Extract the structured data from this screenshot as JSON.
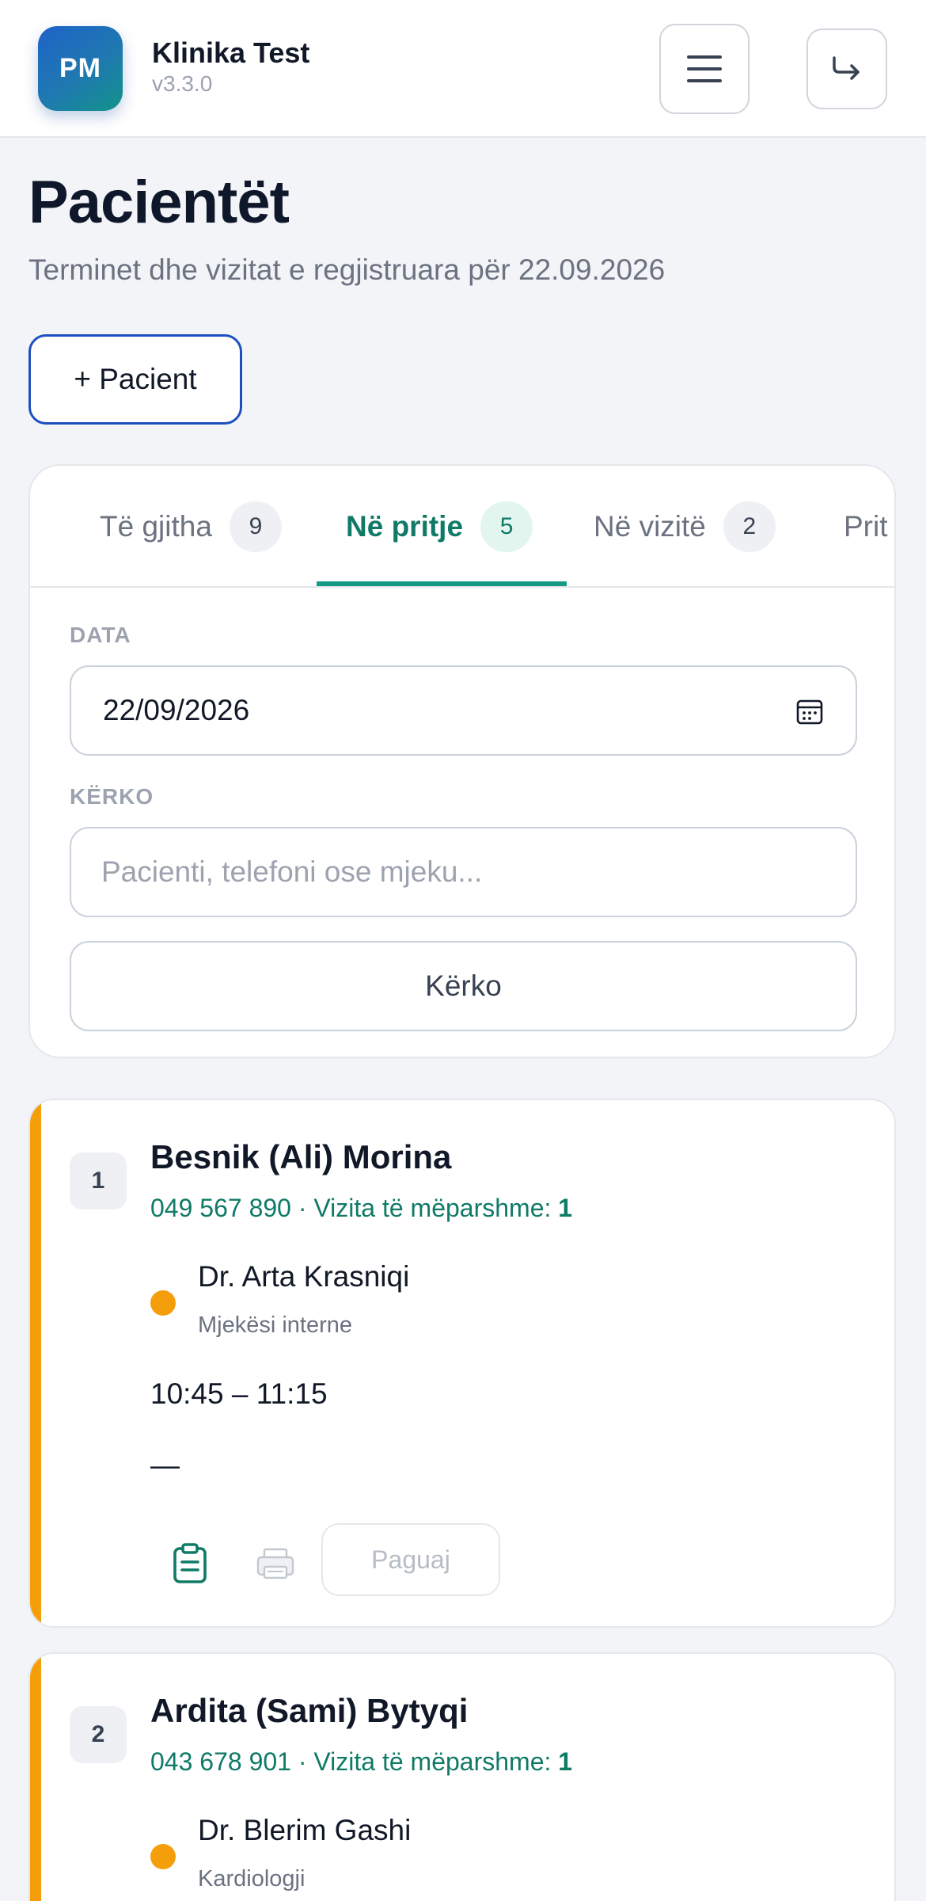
{
  "header": {
    "logo_text": "PM",
    "app_name": "Klinika Test",
    "version": "v3.3.0",
    "menu_icon": "hamburger-icon",
    "logout_icon": "logout-arrow-icon"
  },
  "page": {
    "title": "Pacientët",
    "subtitle": "Terminet dhe vizitat e regjistruara për 22.09.2026",
    "add_button": "+ Pacient"
  },
  "tabs": [
    {
      "label": "Të gjitha",
      "count": "9",
      "active": false
    },
    {
      "label": "Në pritje",
      "count": "5",
      "active": true
    },
    {
      "label": "Në vizitë",
      "count": "2",
      "active": false
    },
    {
      "label": "Prit",
      "count": "",
      "active": false
    }
  ],
  "filters": {
    "date_label": "DATA",
    "date_value": "22/09/2026",
    "search_label": "KËRKO",
    "search_placeholder": "Pacienti, telefoni ose mjeku...",
    "search_button": "Kërko"
  },
  "patients": [
    {
      "number": "1",
      "name": "Besnik (Ali) Morina",
      "phone": "049 567 890",
      "previous_visits_label": " · Vizita të mëparshme: ",
      "previous_visits": "1",
      "doctor": "Dr. Arta Krasniqi",
      "specialty": "Mjekësi interne",
      "time": "10:45 – 11:15",
      "note": "—",
      "pay_button": "Paguaj",
      "status_color": "#f59e0b"
    },
    {
      "number": "2",
      "name": "Ardita (Sami) Bytyqi",
      "phone": "043 678 901",
      "previous_visits_label": " · Vizita të mëparshme: ",
      "previous_visits": "1",
      "doctor": "Dr. Blerim Gashi",
      "specialty": "Kardiologji",
      "status_color": "#f59e0b"
    }
  ],
  "colors": {
    "accent_teal": "#0f7a66",
    "status_waiting": "#f59e0b",
    "primary_blue": "#1e4fbf"
  }
}
